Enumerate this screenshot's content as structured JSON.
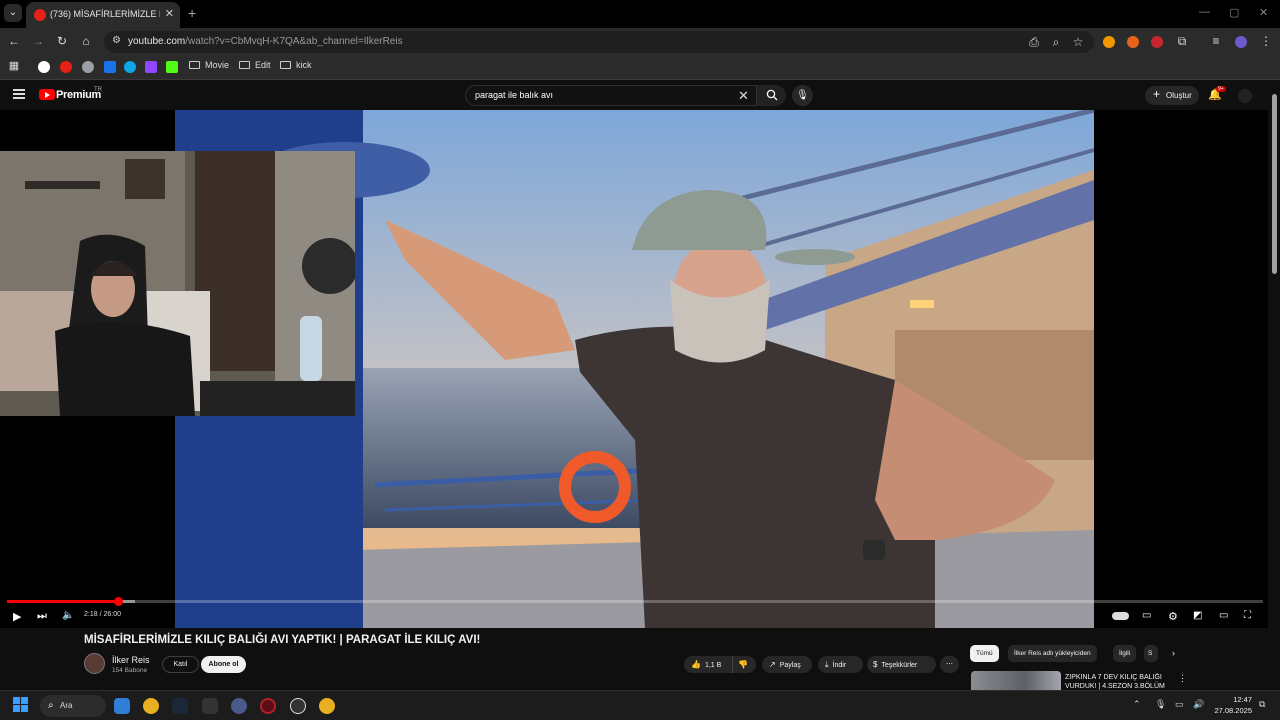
{
  "browser": {
    "tab_title": "(736) MİSAFİRLERİMİZLE KILIÇ BALIĞI",
    "url_host": "youtube.com",
    "url_path": "/watch?v=CbMvqH-K7QA&ab_channel=IlkerReis",
    "bookmarks": [
      {
        "label": "Movie"
      },
      {
        "label": "Edit"
      },
      {
        "label": "kick"
      }
    ]
  },
  "youtube": {
    "brand": "Premium",
    "region": "TR",
    "search_query": "paragat ile balık avı",
    "create_label": "Oluştur",
    "notifications_badge": "9+"
  },
  "player": {
    "time": "2:18 / 26:00",
    "progress_fraction": 0.0885
  },
  "video": {
    "title": "MİSAFİRLERİMİZLE KILIÇ BALIĞI AVI YAPTIK! | PARAGAT İLE KILIÇ AVI!",
    "channel": "İlker Reis",
    "subscribers": "154 Babone",
    "join_label": "Katıl",
    "subscribe_label": "Abone ol",
    "likes": "1,1 B",
    "share_label": "Paylaş",
    "download_label": "İndir",
    "thanks_label": "Teşekkürler"
  },
  "sidebar": {
    "chips": [
      "Tümü",
      "İlker Reis adlı yükleyiciden",
      "İlgili",
      "S"
    ],
    "rec_title": "ZIPKINLA 7 DEV KILIÇ BALIĞI VURDUK! | 4.SEZON 3.BÖLÜM"
  },
  "taskbar": {
    "search_label": "Ara",
    "time": "12:47",
    "date": "27.08.2025"
  },
  "colors": {
    "accent": "#ff0000",
    "background": "#0f0f0f"
  }
}
